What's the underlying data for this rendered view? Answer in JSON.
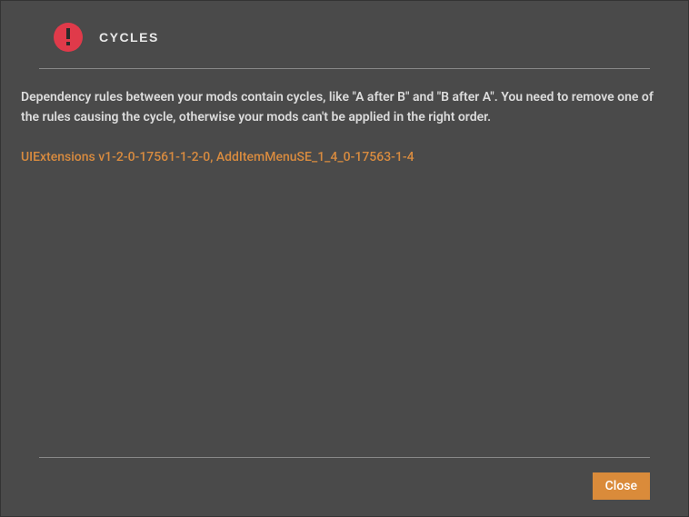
{
  "dialog": {
    "title": "CYCLES",
    "message": "Dependency rules between your mods contain cycles, like \"A after B\" and \"B after A\". You need to remove one of the rules causing the cycle, otherwise your mods can't be applied in the right order.",
    "mod_list": "UIExtensions v1-2-0-17561-1-2-0, AddItemMenuSE_1_4_0-17563-1-4",
    "close_label": "Close"
  }
}
